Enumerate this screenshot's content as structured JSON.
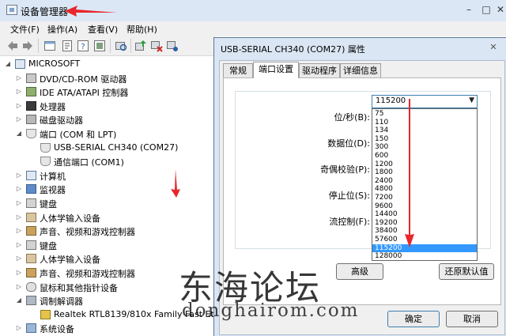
{
  "device_manager": {
    "title": "设备管理器",
    "menu": [
      "文件(F)",
      "操作(A)",
      "查看(V)",
      "帮助(H)"
    ],
    "toolbar_icons": [
      "back-icon",
      "forward-icon",
      "device-view-icon",
      "properties-icon",
      "help-icon",
      "device-list-icon",
      "scan-hardware-icon",
      "update-driver-icon",
      "uninstall-icon",
      "disable-icon"
    ],
    "tree": [
      {
        "label": "MICROSOFT",
        "level": 0,
        "expander": "◢",
        "icon": "computer-icon"
      },
      {
        "label": "DVD/CD-ROM 驱动器",
        "level": 1,
        "expander": "▷",
        "icon": "dvd-drive-icon"
      },
      {
        "label": "IDE ATA/ATAPI 控制器",
        "level": 1,
        "expander": "▷",
        "icon": "ide-controller-icon"
      },
      {
        "label": "处理器",
        "level": 1,
        "expander": "▷",
        "icon": "processor-icon"
      },
      {
        "label": "磁盘驱动器",
        "level": 1,
        "expander": "▷",
        "icon": "disk-drive-icon"
      },
      {
        "label": "端口 (COM 和 LPT)",
        "level": 1,
        "expander": "◢",
        "icon": "port-icon"
      },
      {
        "label": "USB-SERIAL CH340 (COM27)",
        "level": 2,
        "expander": "",
        "icon": "port-icon"
      },
      {
        "label": "通信端口 (COM1)",
        "level": 2,
        "expander": "",
        "icon": "port-icon"
      },
      {
        "label": "计算机",
        "level": 1,
        "expander": "▷",
        "icon": "computer-icon"
      },
      {
        "label": "监视器",
        "level": 1,
        "expander": "▷",
        "icon": "monitor-icon"
      },
      {
        "label": "键盘",
        "level": 1,
        "expander": "▷",
        "icon": "keyboard-icon"
      },
      {
        "label": "人体学输入设备",
        "level": 1,
        "expander": "▷",
        "icon": "hid-icon"
      },
      {
        "label": "声音、视频和游戏控制器",
        "level": 1,
        "expander": "▷",
        "icon": "sound-icon"
      },
      {
        "label": "键盘",
        "level": 1,
        "expander": "▷",
        "icon": "keyboard-icon"
      },
      {
        "label": "人体学输入设备",
        "level": 1,
        "expander": "▷",
        "icon": "hid-icon"
      },
      {
        "label": "声音、视频和游戏控制器",
        "level": 1,
        "expander": "▷",
        "icon": "sound-icon"
      },
      {
        "label": "鼠标和其他指针设备",
        "level": 1,
        "expander": "▷",
        "icon": "mouse-icon"
      },
      {
        "label": "调制解调器",
        "level": 1,
        "expander": "◢",
        "icon": "modem-icon"
      },
      {
        "label": "Realtek RTL8139/810x Family Fast Et",
        "level": 2,
        "expander": "",
        "icon": "network-adapter-icon"
      },
      {
        "label": "系统设备",
        "level": 1,
        "expander": "▷",
        "icon": "system-device-icon"
      }
    ]
  },
  "properties_dialog": {
    "title": "USB-SERIAL CH340 (COM27) 属性",
    "close": "✕",
    "tabs": [
      "常规",
      "端口设置",
      "驱动程序",
      "详细信息"
    ],
    "active_tab": 1,
    "fields": [
      {
        "label": "位/秒(B):"
      },
      {
        "label": "数据位(D):"
      },
      {
        "label": "奇偶校验(P):"
      },
      {
        "label": "停止位(S):"
      },
      {
        "label": "流控制(F):"
      }
    ],
    "baud_rate": {
      "value": "115200",
      "options": [
        "75",
        "110",
        "134",
        "150",
        "300",
        "600",
        "1200",
        "1800",
        "2400",
        "4800",
        "7200",
        "9600",
        "14400",
        "19200",
        "38400",
        "57600",
        "115200",
        "128000"
      ],
      "selected": "115200"
    },
    "advanced_button": "高级",
    "restore_button": "还原默认值",
    "ok_button": "确定",
    "cancel_button": "取消"
  },
  "watermark": {
    "cn": "东海论坛",
    "en": "donghairom.com"
  },
  "colors": {
    "annotation_arrow": "#e8262b",
    "selection": "#3399ff",
    "title_bar": "#dbe7f4"
  }
}
